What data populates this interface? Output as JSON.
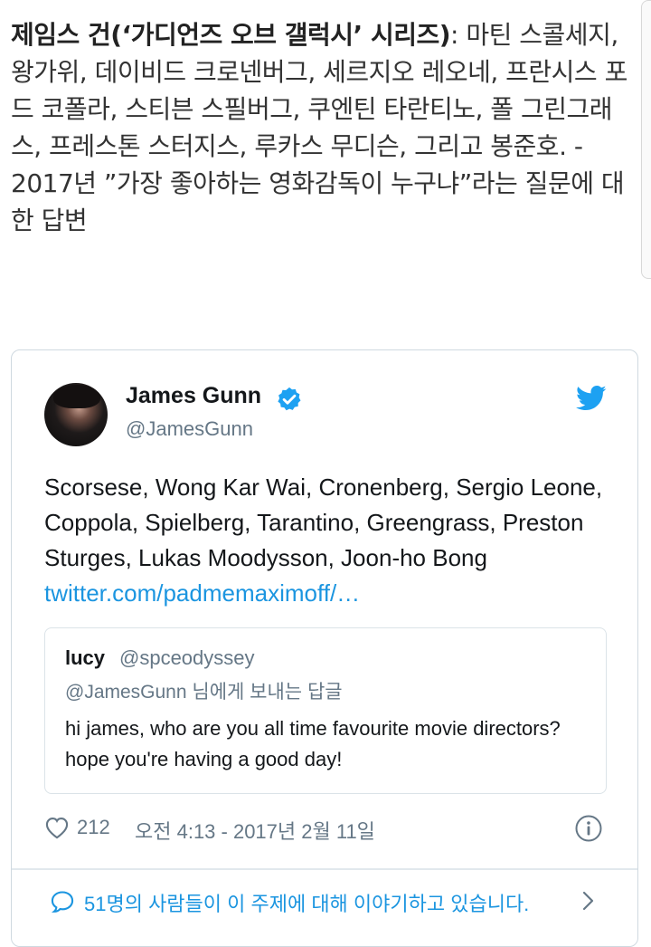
{
  "article": {
    "bold_text": "제임스 건(‘가디언즈 오브 갤럭시’ 시리즈)",
    "body_text": ": 마틴 스콜세지, 왕가위, 데이비드 크로넨버그, 세르지오 레오네, 프란시스 포드 코폴라, 스티븐 스필버그, 쿠엔틴 타란티노, 폴 그린그래스, 프레스톤 스터지스, 루카스 무디슨, 그리고 봉준호. - 2017년 ”가장 좋아하는 영화감독이 누구냐”라는 질문에 대한 답변"
  },
  "tweet": {
    "display_name": "James Gunn",
    "handle": "@JamesGunn",
    "text": "Scorsese, Wong Kar Wai, Cronenberg, Sergio Leone, Coppola, Spielberg, Tarantino, Greengrass, Preston Sturges, Lukas Moodysson, Joon-ho Bong ",
    "link": "twitter.com/padmemaximoff/…",
    "likes": "212",
    "timestamp": "오전 4:13 - 2017년 2월 11일",
    "conversation": "51명의 사람들이 이 주제에 대해 이야기하고 있습니다."
  },
  "quote": {
    "name": "lucy",
    "handle": "@spceodyssey",
    "reply_to": "@JamesGunn 님에게 보내는 답글",
    "text": "hi james, who are you all time favourite movie directors? hope you're having a good day!"
  },
  "colors": {
    "link": "#1b95e0",
    "secondary_text": "#657786",
    "border": "#cfd9e0"
  },
  "icons": [
    "verified-badge-icon",
    "twitter-bird-icon",
    "heart-icon",
    "info-icon",
    "speech-bubble-icon",
    "chevron-right-icon"
  ]
}
